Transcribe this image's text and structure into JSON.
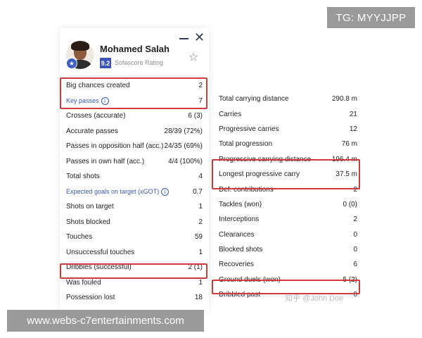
{
  "watermarks": {
    "tg_label": "TG: MYYJJPP",
    "site_url": "www.webs-c7entertainments.com",
    "zhihu_text": "知乎 @John Doe"
  },
  "player": {
    "name": "Mohamed Salah",
    "rating": "9.2",
    "rating_label": "Sofascore Rating"
  },
  "icons": {
    "minimize": "minimize-icon",
    "close": "close-icon",
    "favorite": "star-outline-icon",
    "info": "info-icon",
    "badge": "star-badge-icon"
  },
  "colors": {
    "highlight": "#cf3a3d",
    "accent": "#3a57b8"
  },
  "left_stats": [
    {
      "label": "Big chances created",
      "value": "2"
    },
    {
      "label": "Key passes",
      "value": "7",
      "style": "blue",
      "info": true
    },
    {
      "label": "Crosses (accurate)",
      "value": "6 (3)"
    },
    {
      "label": "Accurate passes",
      "value": "28/39 (72%)"
    },
    {
      "label": "Passes in opposition half (acc.)",
      "value": "24/35 (69%)"
    },
    {
      "label": "Passes in own half (acc.)",
      "value": "4/4 (100%)"
    },
    {
      "label": "Total shots",
      "value": "4"
    },
    {
      "label": "Expected goals on target (xGOT)",
      "value": "0.7",
      "style": "blue",
      "info": true
    },
    {
      "label": "Shots on target",
      "value": "1"
    },
    {
      "label": "Shots blocked",
      "value": "2"
    },
    {
      "label": "Touches",
      "value": "59"
    },
    {
      "label": "Unsuccessful touches",
      "value": "1"
    },
    {
      "label": "Dribbles (successful)",
      "value": "2 (1)"
    },
    {
      "label": "Was fouled",
      "value": "1"
    },
    {
      "label": "Possession lost",
      "value": "18"
    }
  ],
  "right_stats": [
    {
      "label": "Total carrying distance",
      "value": "290.8 m"
    },
    {
      "label": "Carries",
      "value": "21"
    },
    {
      "label": "Progressive carries",
      "value": "12"
    },
    {
      "label": "Total progression",
      "value": "76 m"
    },
    {
      "label": "Progressive carrying distance",
      "value": "196.4 m"
    },
    {
      "label": "Longest progressive carry",
      "value": "37.5 m"
    },
    {
      "label": "Def. contributions",
      "value": "2"
    },
    {
      "label": "Tackles (won)",
      "value": "0 (0)"
    },
    {
      "label": "Interceptions",
      "value": "2"
    },
    {
      "label": "Clearances",
      "value": "0"
    },
    {
      "label": "Blocked shots",
      "value": "0"
    },
    {
      "label": "Recoveries",
      "value": "6"
    },
    {
      "label": "Ground duels (won)",
      "value": "5 (2)"
    },
    {
      "label": "Dribbled past",
      "value": "0"
    }
  ]
}
